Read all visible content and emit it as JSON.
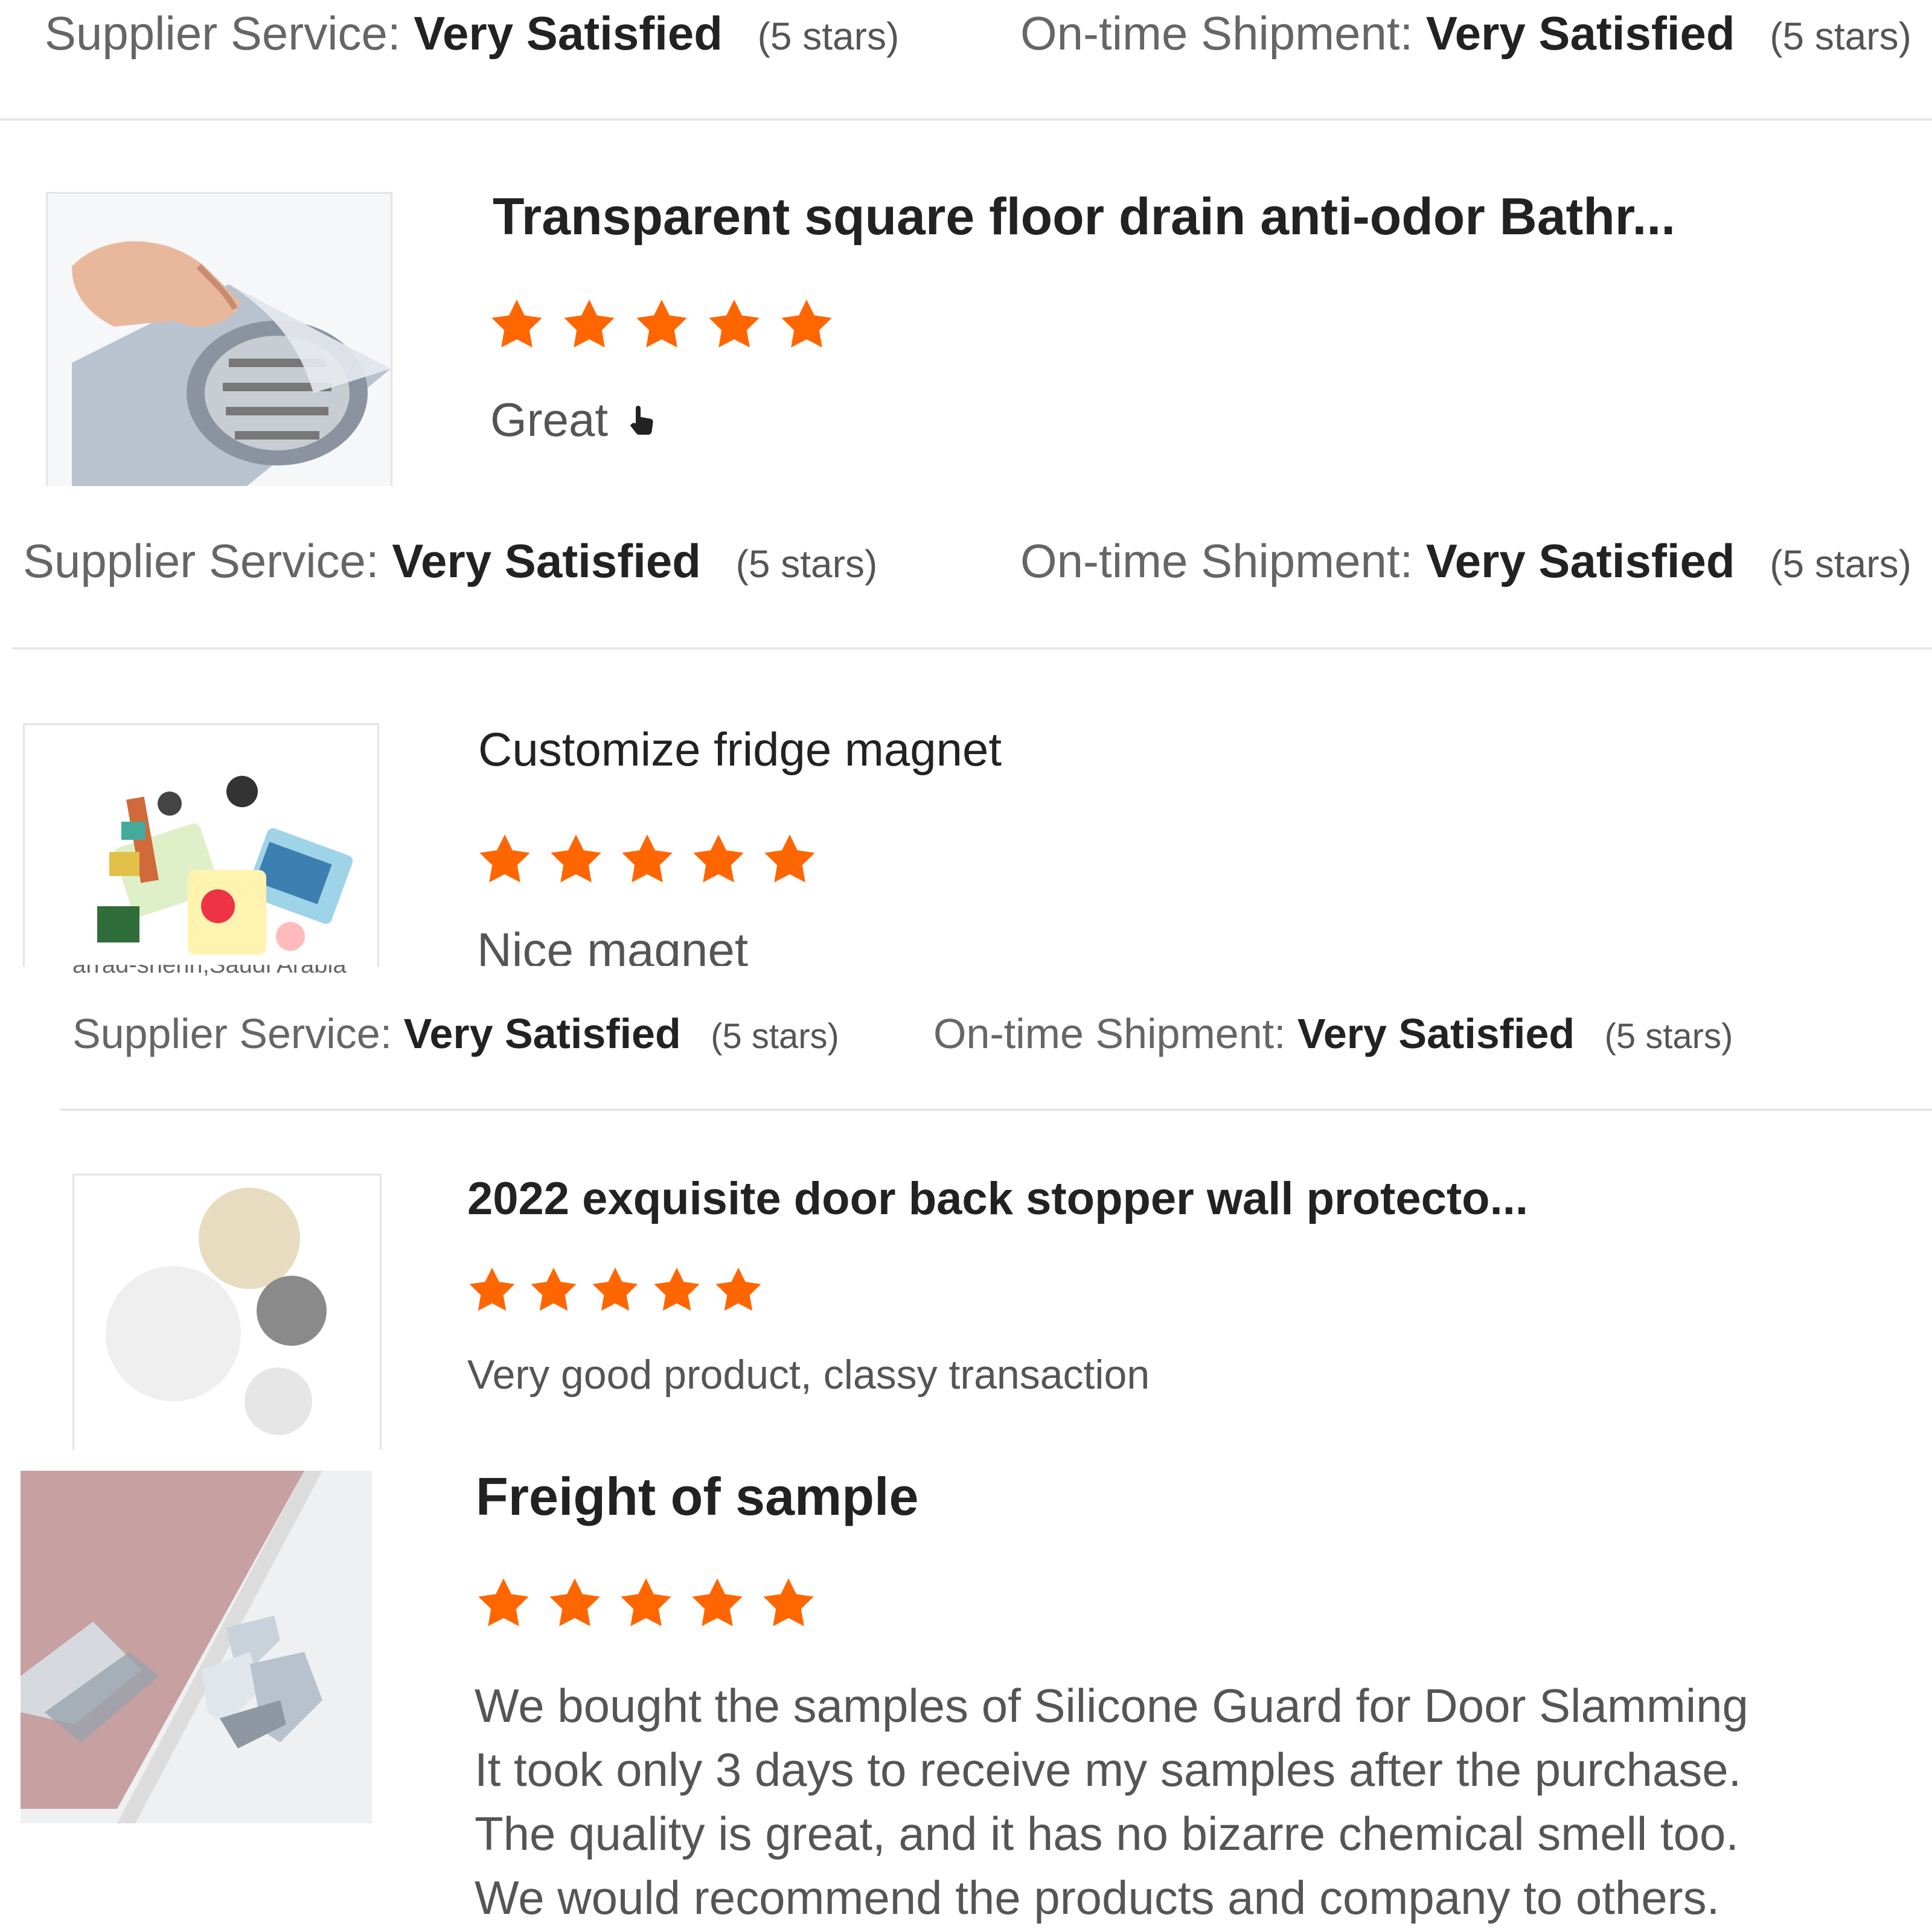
{
  "colors": {
    "star": "#ff6600",
    "divider": "#e6e6e6"
  },
  "meta_labels": {
    "supplier": "Supplier Service:",
    "shipment": "On-time Shipment:",
    "value": "Very Satisfied",
    "stars_note": "(5 stars)"
  },
  "reviews": [
    {
      "title": "Transparent square floor drain anti-odor Bathr...",
      "rating": 5,
      "comment": "Great",
      "comment_icon": "hand-pointer-icon"
    },
    {
      "title": "Customize fridge magnet",
      "rating": 5,
      "comment": "Nice magnet",
      "location_fragment": "arrad-shehri,Saudi Arabia"
    },
    {
      "title": "2022 exquisite door back stopper wall protecto...",
      "rating": 5,
      "comment": "Very good product, classy transaction"
    },
    {
      "title": "Freight of sample",
      "rating": 5,
      "comment_lines": [
        "We bought the samples of Silicone Guard for Door Slamming",
        "It took only 3 days to receive my samples after the purchase.",
        "The quality is great, and it has no bizarre chemical smell too.",
        "We would recommend the products and company to others."
      ]
    }
  ]
}
